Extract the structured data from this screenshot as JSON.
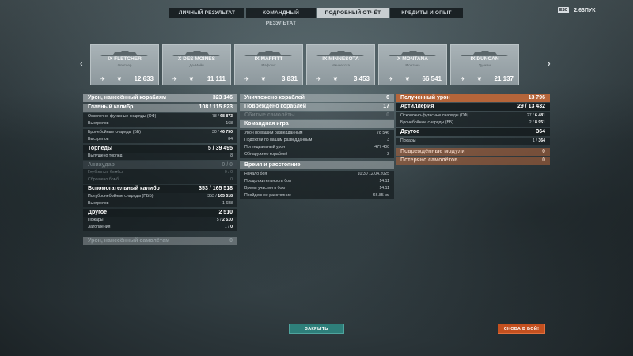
{
  "tabs": [
    {
      "label": "ЛИЧНЫЙ РЕЗУЛЬТАТ",
      "active": false
    },
    {
      "label": "КОМАНДНЫЙ РЕЗУЛЬТАТ",
      "active": false
    },
    {
      "label": "ПОДРОБНЫЙ ОТЧЁТ",
      "active": true
    },
    {
      "label": "КРЕДИТЫ И ОПЫТ",
      "active": false
    }
  ],
  "corner": {
    "esc_label": "ESC",
    "value": "2.63ПУК"
  },
  "carousel": {
    "prev_icon": "chevron-left-icon",
    "next_icon": "chevron-right-icon",
    "ships": [
      {
        "name": "IX FLETCHER",
        "sub": "Флетчер",
        "value": "12 633"
      },
      {
        "name": "X DES MOINES",
        "sub": "Де-Мойн",
        "value": "11 111"
      },
      {
        "name": "IX MAFFITT",
        "sub": "Маффит",
        "value": "3 831"
      },
      {
        "name": "IX MINNESOTA",
        "sub": "Миннесота",
        "value": "3 453"
      },
      {
        "name": "X MONTANA",
        "sub": "Монтана",
        "value": "66 541"
      },
      {
        "name": "IX DUNCAN",
        "sub": "Дункан",
        "value": "21 137"
      }
    ]
  },
  "left": {
    "damage_title": "Урон, нанесённый кораблям",
    "damage_value": "323 146",
    "main_caliber": {
      "label": "Главный калибр",
      "hits": "108",
      "damage": "115 823"
    },
    "he": {
      "label": "Осколочно-фугасные снаряды (ОФ)",
      "hits": "78",
      "damage": "68 873"
    },
    "he_shots": {
      "label": "Выстрелов",
      "value": "168"
    },
    "ap": {
      "label": "Бронебойные снаряды (ББ)",
      "hits": "30",
      "damage": "46 750"
    },
    "ap_shots": {
      "label": "Выстрелов",
      "value": "84"
    },
    "torpedoes": {
      "label": "Торпеды",
      "hits": "5",
      "damage": "39 495"
    },
    "torp_launched": {
      "label": "Выпущено торпед",
      "value": "8"
    },
    "air_strike": {
      "label": "Авиаудар",
      "hits": "0",
      "damage": "0"
    },
    "depth_bombs": {
      "label": "Глубинные бомбы",
      "hits": "0",
      "damage": "0"
    },
    "dropped_bombs": {
      "label": "Сброшено бомб",
      "value": "0"
    },
    "secondary": {
      "label": "Вспомогательный калибр",
      "hits": "353",
      "damage": "165 518"
    },
    "sap": {
      "label": "Полубронебойные снаряды (ПББ)",
      "hits": "353",
      "damage": "165 518"
    },
    "sap_shots": {
      "label": "Выстрелов",
      "value": "1 688"
    },
    "other": {
      "label": "Другое",
      "value": "2 510"
    },
    "fires": {
      "label": "Пожары",
      "count": "5",
      "damage": "2 510"
    },
    "floods": {
      "label": "Затопления",
      "count": "1",
      "damage": "0"
    },
    "planes_damage": {
      "label": "Урон, нанесённый самолётам",
      "value": "0"
    }
  },
  "middle": {
    "destroyed": {
      "label": "Уничтожено кораблей",
      "value": "6"
    },
    "damaged": {
      "label": "Повреждено кораблей",
      "value": "17"
    },
    "planes_shot": {
      "label": "Сбитые самолёты",
      "value": "0"
    },
    "team_title": "Командная игра",
    "spotting_damage": {
      "label": "Урон по вашим разведданным",
      "value": "78 546"
    },
    "spotted_fires": {
      "label": "Подожгли по вашим разведданным",
      "value": "3"
    },
    "potential": {
      "label": "Потенциальный урон",
      "value": "477 400"
    },
    "spotted": {
      "label": "Обнаружено кораблей",
      "value": "2"
    },
    "time_title": "Время и расстояние",
    "battle_start": {
      "label": "Начало боя",
      "value": "10:30  12.04.2025"
    },
    "duration": {
      "label": "Продолжительность боя",
      "value": "14:11"
    },
    "alive": {
      "label": "Время участия в бою",
      "value": "14:11"
    },
    "distance": {
      "label": "Пройденное расстояние",
      "value": "66.85 км"
    }
  },
  "right": {
    "received_title": "Полученный урон",
    "received_value": "13 796",
    "artillery": {
      "label": "Артиллерия",
      "hits": "29",
      "damage": "13 432"
    },
    "he": {
      "label": "Осколочно-фугасные снаряды (ОФ)",
      "hits": "27",
      "damage": "6 481"
    },
    "ap": {
      "label": "Бронебойные снаряды (ББ)",
      "hits": "2",
      "damage": "8 951"
    },
    "other": {
      "label": "Другое",
      "value": "364"
    },
    "fires": {
      "label": "Пожары",
      "count": "1",
      "damage": "364"
    },
    "modules": {
      "label": "Повреждённые модули",
      "value": "0"
    },
    "planes_lost": {
      "label": "Потеряно самолётов",
      "value": "0"
    }
  },
  "buttons": {
    "close": "ЗАКРЫТЬ",
    "battle": "СНОВА В БОЙ!"
  }
}
